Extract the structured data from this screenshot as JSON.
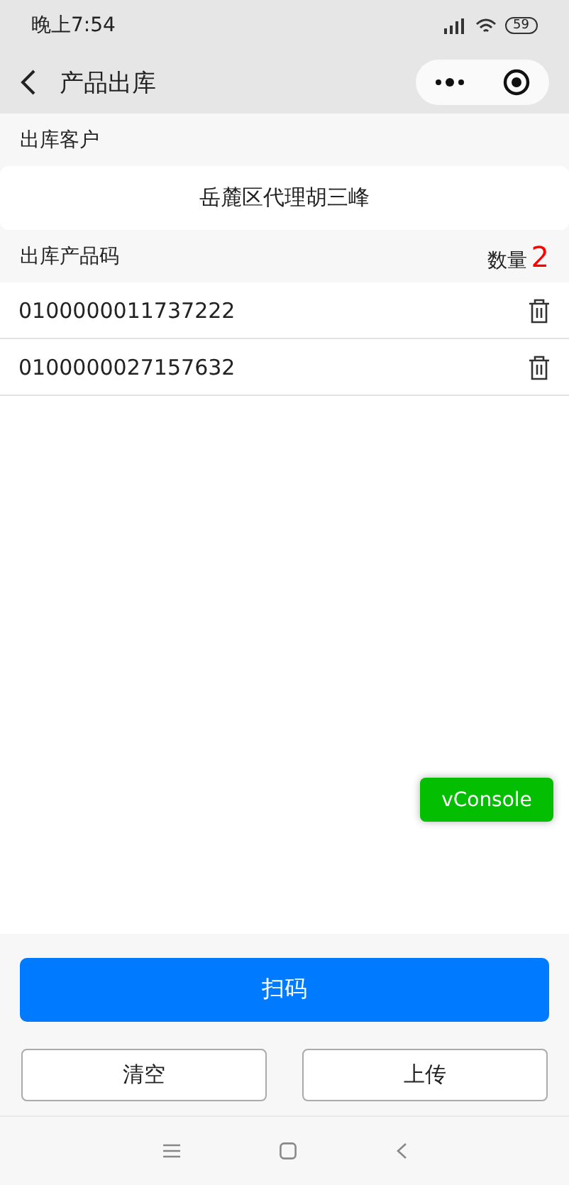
{
  "status_bar": {
    "time": "晚上7:54",
    "battery": "59"
  },
  "nav": {
    "title": "产品出库"
  },
  "customer": {
    "label": "出库客户",
    "value": "岳麓区代理胡三峰"
  },
  "products": {
    "label": "出库产品码",
    "count_label": "数量",
    "count": "2",
    "rows": [
      {
        "code": "0100000011737222"
      },
      {
        "code": "0100000027157632"
      }
    ]
  },
  "vconsole": "vConsole",
  "scan_button": "扫码",
  "buttons": [
    "清空",
    "上传"
  ]
}
